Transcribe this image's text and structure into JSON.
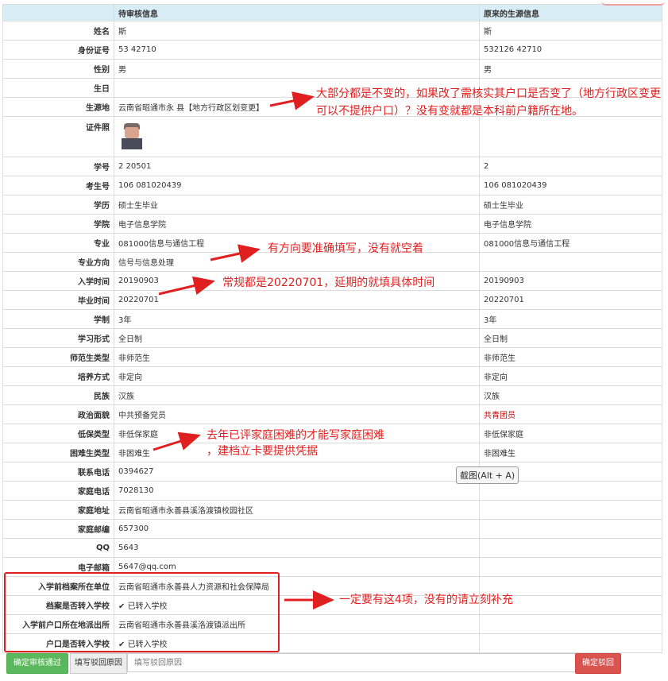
{
  "header": {
    "pending": "待审核信息",
    "original": "原来的生源信息"
  },
  "rows": [
    {
      "label": "姓名",
      "pending": "斯",
      "original": "斯"
    },
    {
      "label": "身份证号",
      "pending": "53                42710",
      "original": "532126            42710"
    },
    {
      "label": "性别",
      "pending": "男",
      "original": "男"
    },
    {
      "label": "生日",
      "pending": "",
      "original": ""
    },
    {
      "label": "生源地",
      "pending": "云南省昭通市永  县【地方行政区划变更】",
      "original": ""
    },
    {
      "label": "证件照",
      "pending": "",
      "original": ""
    },
    {
      "label": "学号",
      "pending": "2         20501",
      "original": "2"
    },
    {
      "label": "考生号",
      "pending": "106      081020439",
      "original": "106      081020439"
    },
    {
      "label": "学历",
      "pending": "硕士生毕业",
      "original": "硕士生毕业"
    },
    {
      "label": "学院",
      "pending": "电子信息学院",
      "original": "电子信息学院"
    },
    {
      "label": "专业",
      "pending": "081000信息与通信工程",
      "original": "081000信息与通信工程"
    },
    {
      "label": "专业方向",
      "pending": "信号与信息处理",
      "original": ""
    },
    {
      "label": "入学时间",
      "pending": "20190903",
      "original": "20190903"
    },
    {
      "label": "毕业时间",
      "pending": "20220701",
      "original": "20220701"
    },
    {
      "label": "学制",
      "pending": "3年",
      "original": "3年"
    },
    {
      "label": "学习形式",
      "pending": "全日制",
      "original": "全日制"
    },
    {
      "label": "师范生类型",
      "pending": "非师范生",
      "original": "非师范生"
    },
    {
      "label": "培养方式",
      "pending": "非定向",
      "original": "非定向"
    },
    {
      "label": "民族",
      "pending": "汉族",
      "original": "汉族"
    },
    {
      "label": "政治面貌",
      "pending": "中共预备党员",
      "original": "共青团员"
    },
    {
      "label": "低保类型",
      "pending": "非低保家庭",
      "original": "非低保家庭"
    },
    {
      "label": "困难生类型",
      "pending": "非困难生",
      "original": "非困难生"
    },
    {
      "label": "联系电话",
      "pending": "0394627",
      "original": ""
    },
    {
      "label": "家庭电话",
      "pending": "7028130",
      "original": ""
    },
    {
      "label": "家庭地址",
      "pending": "云南省昭通市永善县溪洛渡镇校园社区",
      "original": ""
    },
    {
      "label": "家庭邮编",
      "pending": "657300",
      "original": ""
    },
    {
      "label": "QQ",
      "pending": "5643",
      "original": ""
    },
    {
      "label": "电子邮箱",
      "pending": "5647@qq.com",
      "original": ""
    },
    {
      "label": "入学前档案所在单位",
      "pending": "云南省昭通市永善县人力资源和社会保障局",
      "original": ""
    },
    {
      "label": "档案是否转入学校",
      "pending": "已转入学校",
      "original": ""
    },
    {
      "label": "入学前户口所在地派出所",
      "pending": "云南省昭通市永善县溪洛渡镇派出所",
      "original": ""
    },
    {
      "label": "户口是否转入学校",
      "pending": "已转入学校",
      "original": ""
    }
  ],
  "notes": {
    "note1": "大部分都是不变的，如果改了需核实其户口是否变了（地方行政区变更可以不提供户口）？没有变就都是本科前户籍所在地。",
    "note2": "有方向要准确填写，没有就空着",
    "note3": "常规都是20220701，延期的就填具体时间",
    "note4a": "去年已评家庭困难的才能写家庭困难",
    "note4b": "，建档立卡要提供凭据",
    "note5": "一定要有这4项，没有的请立刻补充"
  },
  "tooltip": "截图(Alt + A)",
  "bottom": {
    "approve": "确定审核通过",
    "reason_label": "填写驳回原因",
    "reason_placeholder": "填写驳回原因",
    "reject": "确定驳回"
  },
  "colors": {
    "header_bg": "#d9edf7",
    "annotation": "#e02020",
    "approve": "#5cb85c",
    "reject": "#d9534f"
  }
}
